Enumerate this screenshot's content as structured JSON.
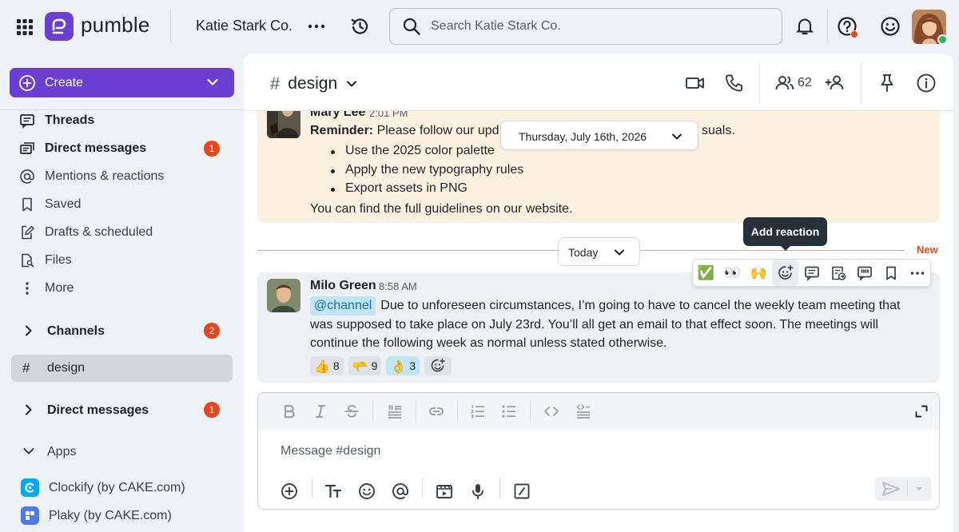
{
  "app": {
    "name": "pumble",
    "workspace": "Katie Stark Co."
  },
  "search": {
    "placeholder": "Search Katie Stark Co."
  },
  "sidebar": {
    "create_label": "Create",
    "items": [
      {
        "label": "Threads",
        "bold": true
      },
      {
        "label": "Direct messages",
        "bold": true,
        "badge": "1"
      },
      {
        "label": "Mentions & reactions"
      },
      {
        "label": "Saved"
      },
      {
        "label": "Drafts & scheduled"
      },
      {
        "label": "Files"
      },
      {
        "label": "More"
      }
    ],
    "channels_label": "Channels",
    "channels_badge": "2",
    "active_channel": "design",
    "dm_label": "Direct messages",
    "dm_badge": "1",
    "apps_label": "Apps",
    "apps": [
      {
        "label": "Clockify (by CAKE.com)",
        "color": "#03a9f4"
      },
      {
        "label": "Plaky (by CAKE.com)",
        "color": "#4a7cf0"
      }
    ]
  },
  "channel": {
    "hash": "#",
    "name": "design",
    "member_count": "62"
  },
  "messages": {
    "reminder": {
      "author": "Mary Lee",
      "time": "2:01 PM",
      "lead": "Reminder:",
      "text_start": " Please follow our upd",
      "text_end": "suals.",
      "bullets": [
        "Use the 2025 color palette",
        "Apply the new typography rules",
        "Export assets in PNG"
      ],
      "footer": "You can find the full guidelines on our website."
    },
    "date_divider": "Thursday, July 16th, 2026",
    "today_divider": "Today",
    "new_label": "New",
    "tooltip": "Add reaction",
    "milo": {
      "author": "Milo Green",
      "time": "8:58 AM",
      "mention": "@channel",
      "text": "Due to unforeseen circumstances, I’m going to have to cancel the weekly team meeting that was supposed to take place on July 23rd. You’ll all get an email to that effect soon. The meetings will continue the following week as normal unless stated otherwise.",
      "reactions": [
        {
          "emoji": "👍",
          "count": "8",
          "mine": false
        },
        {
          "emoji": "🫳",
          "count": "9",
          "mine": false
        },
        {
          "emoji": "👌",
          "count": "3",
          "mine": true
        }
      ]
    }
  },
  "hover_actions": {
    "quick_emojis": [
      "✅",
      "👀",
      "🙌"
    ]
  },
  "composer": {
    "placeholder": "Message #design"
  },
  "colors": {
    "brand": "#6a3fd1",
    "badge": "#e5451f",
    "online": "#2fb457",
    "reminder_bg": "#fdf2e2",
    "mention_bg": "#bfe6f7"
  }
}
